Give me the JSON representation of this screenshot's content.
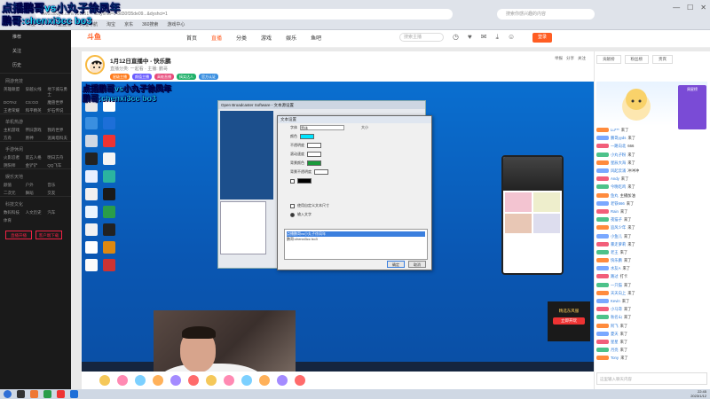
{
  "browser": {
    "url": "www.douyu.com/101151?...&dyshid=0-8d30f35de09...&dyshci=1",
    "search_placeholder": "搜索你感兴趣的内容",
    "bookmarks": [
      "百度一下",
      "斗鱼直播",
      "网址导航",
      "淘宝",
      "京东",
      "360搜索",
      "游戏中心"
    ]
  },
  "site": {
    "logo": "斗鱼",
    "nav": [
      "首页",
      "直播",
      "分类",
      "游戏",
      "娱乐",
      "鱼吧"
    ],
    "active_nav": "直播",
    "search_placeholder": "搜索主播",
    "login": "登录"
  },
  "sidebar": {
    "top_items": [
      "推荐",
      "关注",
      "历史"
    ],
    "sections": [
      {
        "title": "网游竞技",
        "items": [
          "英雄联盟",
          "穿越火线",
          "地下城与勇士",
          "DOTA2",
          "CS:GO",
          "魔兽世界",
          "王者荣耀",
          "和平精英",
          "炉石传说"
        ]
      },
      {
        "title": "单机热游",
        "items": [
          "主机游戏",
          "怀旧游戏",
          "我的世界",
          "方舟",
          "原神",
          "逃离塔科夫"
        ]
      },
      {
        "title": "手游休闲",
        "items": [
          "火影忍者",
          "第五人格",
          "明日方舟",
          "阴阳师",
          "金铲铲",
          "QQ飞车"
        ]
      },
      {
        "title": "娱乐天地",
        "items": [
          "颜值",
          "户外",
          "音乐",
          "二次元",
          "舞蹈",
          "交友"
        ]
      },
      {
        "title": "科技文化",
        "items": [
          "数码科技",
          "人文历史",
          "汽车",
          "体育"
        ]
      }
    ],
    "bottom_buttons": [
      "直播开播",
      "客户端下载"
    ]
  },
  "room": {
    "title": "1月12日直播中 - 快乐鹏",
    "meta": "直播分类: 一起看 · 主播: 鹏哥",
    "tags": [
      "星级主播",
      "颜值主播",
      "高能直播",
      "搞笑达人",
      "官方认证"
    ],
    "right_actions": [
      "举报",
      "分享",
      "关注"
    ]
  },
  "overlay": {
    "line1": "点播鹏哥vs小丸子徐凤年",
    "line2": "鹏哥:chenxi3cc bo3",
    "mid1": "点播鹏哥vs小丸子徐凤年",
    "mid2": "鹏哥:chenxi3cc bo3"
  },
  "dialog": {
    "window_title": "Open Broadcaster Software - 文本源设置",
    "title": "文本设置",
    "rows": [
      "字体",
      "颜色",
      "不透明度",
      "滚动速度",
      "背景颜色",
      "背景不透明度"
    ],
    "font_value": "黑体",
    "size_label": "大小",
    "checkbox": "使用自定义文本尺寸",
    "input_label": "输入文字",
    "text_line1": "点播鹏哥vs小丸子徐凤年",
    "text_line2": "鹏哥:chenxi3cc bo3",
    "ok": "确定",
    "cancel": "取消",
    "colors": {
      "text": "#00e5ff",
      "bg": "#1a9a3a",
      "outline": "#000000"
    }
  },
  "ad": {
    "line1": "精选东风服",
    "btn": "立即开玩"
  },
  "rpanel": {
    "tabs": [
      "贡献榜",
      "粉丝榜",
      "贵宾"
    ],
    "rank_label": "周星榜",
    "input_placeholder": "这里输入聊天内容"
  },
  "chat": [
    {
      "name": "Lu***",
      "text": "来了"
    },
    {
      "name": "鹏哥yyds",
      "text": "来了"
    },
    {
      "name": "一路向北",
      "text": "666"
    },
    {
      "name": "小丸子粉",
      "text": "来了"
    },
    {
      "name": "星辰大海",
      "text": "来了"
    },
    {
      "name": "风起云涌",
      "text": "冲冲冲"
    },
    {
      "name": "Andy",
      "text": "来了"
    },
    {
      "name": "今晚吃鸡",
      "text": "来了"
    },
    {
      "name": "鱼丸",
      "text": "主播加油"
    },
    {
      "name": "老铁666",
      "text": "来了"
    },
    {
      "name": "Rain",
      "text": "来了"
    },
    {
      "name": "夜猫子",
      "text": "来了"
    },
    {
      "name": "追风少年",
      "text": "来了"
    },
    {
      "name": "小鱼儿",
      "text": "来了"
    },
    {
      "name": "暴走萝莉",
      "text": "来了"
    },
    {
      "name": "老王",
      "text": "来了"
    },
    {
      "name": "快乐鹏",
      "text": "来了"
    },
    {
      "name": "水友A",
      "text": "来了"
    },
    {
      "name": "路过",
      "text": "打卡"
    },
    {
      "name": "一只猫",
      "text": "来了"
    },
    {
      "name": "天天向上",
      "text": "来了"
    },
    {
      "name": "Kevin",
      "text": "来了"
    },
    {
      "name": "小马哥",
      "text": "来了"
    },
    {
      "name": "秋名山",
      "text": "来了"
    },
    {
      "name": "阿飞",
      "text": "来了"
    },
    {
      "name": "夏天",
      "text": "来了"
    },
    {
      "name": "星星",
      "text": "来了"
    },
    {
      "name": "月亮",
      "text": "来了"
    },
    {
      "name": "Tony",
      "text": "来了"
    }
  ],
  "clock": {
    "time": "22:45",
    "date": "2023/1/12"
  }
}
